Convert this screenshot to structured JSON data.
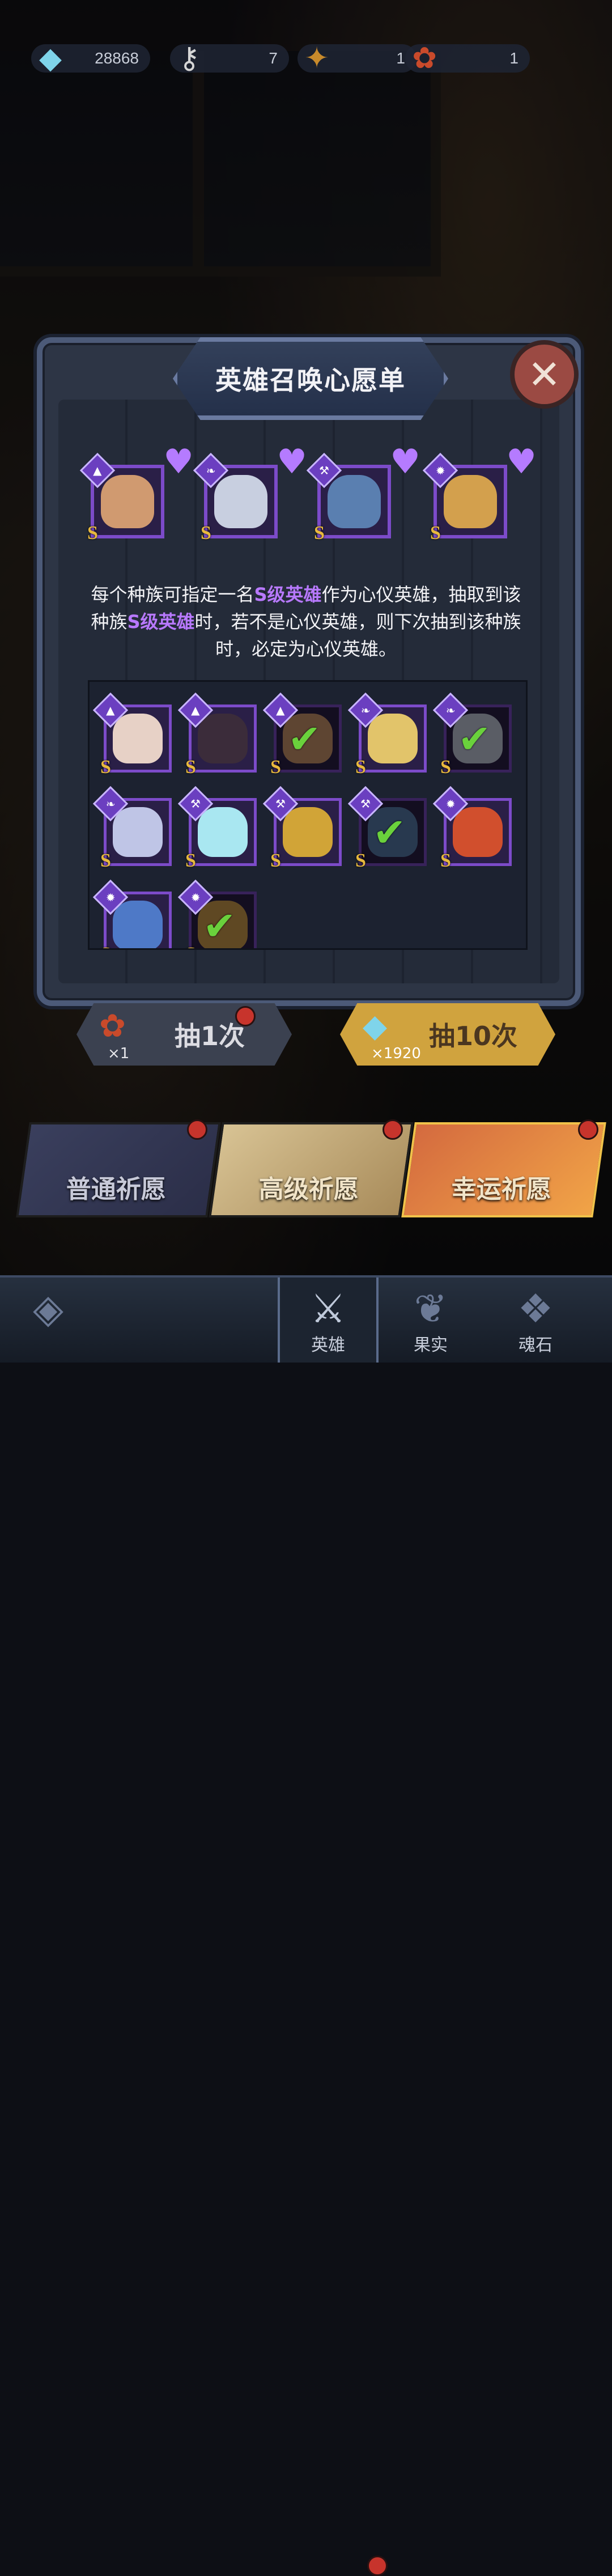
{
  "resources": [
    {
      "icon": "diamond-icon",
      "value": "28868"
    },
    {
      "icon": "key-icon",
      "value": "7"
    },
    {
      "icon": "scroll-icon",
      "value": "1"
    },
    {
      "icon": "ticket-icon",
      "value": "1"
    }
  ],
  "dialog": {
    "title": "英雄召唤心愿单",
    "close_symbol": "✕",
    "description_parts": [
      "每个种族可指定一名",
      "S级英雄",
      "作为心仪英雄，抽取到该种族",
      "S级英雄",
      "时，若不是心仪英雄，则下次抽到该种族时，必定为心仪英雄。"
    ],
    "wish_heroes": [
      {
        "race": "wizard-hat-icon",
        "tier": "S",
        "face": "#d09a70"
      },
      {
        "race": "wing-icon",
        "tier": "S",
        "face": "#c8cfe0"
      },
      {
        "race": "wrench-icon",
        "tier": "S",
        "face": "#5a7fb0"
      },
      {
        "race": "beast-icon",
        "tier": "S",
        "face": "#d3a04d"
      }
    ],
    "grid_heroes": [
      {
        "race": "wizard-hat-icon",
        "tier": "S",
        "face": "#e7d1c6",
        "owned": false
      },
      {
        "race": "wizard-hat-icon",
        "tier": "S",
        "face": "#3b2c3a",
        "owned": false
      },
      {
        "race": "wizard-hat-icon",
        "tier": "S",
        "face": "#d09a70",
        "owned": true
      },
      {
        "race": "wing-icon",
        "tier": "S",
        "face": "#e2c46a",
        "owned": false
      },
      {
        "race": "wing-icon",
        "tier": "S",
        "face": "#c8cfe0",
        "owned": true
      },
      {
        "race": "wing-icon",
        "tier": "S",
        "face": "#bfc5e6",
        "owned": false
      },
      {
        "race": "wrench-icon",
        "tier": "S",
        "face": "#a9e7f1",
        "owned": false
      },
      {
        "race": "wrench-icon",
        "tier": "S",
        "face": "#d1a437",
        "owned": false
      },
      {
        "race": "wrench-icon",
        "tier": "S",
        "face": "#5a7fb0",
        "owned": true
      },
      {
        "race": "beast-icon",
        "tier": "S",
        "face": "#d14f2d",
        "owned": false
      },
      {
        "race": "beast-icon",
        "tier": "S",
        "face": "#4e79c7",
        "owned": false
      },
      {
        "race": "beast-icon",
        "tier": "S",
        "face": "#d3a04d",
        "owned": true
      }
    ]
  },
  "draw_buttons": [
    {
      "label": "抽1次",
      "cost": "×1",
      "cost_icon": "ticket-icon"
    },
    {
      "label": "抽10次",
      "cost": "×1920",
      "cost_icon": "diamond-icon"
    }
  ],
  "banners": [
    {
      "label": "普通祈愿"
    },
    {
      "label": "高级祈愿"
    },
    {
      "label": "幸运祈愿"
    }
  ],
  "nav": [
    {
      "label": "",
      "icon": "menu-emblem-icon"
    },
    {
      "label": "英雄",
      "icon": "hero-helmet-icon"
    },
    {
      "label": "果实",
      "icon": "fruit-icon"
    },
    {
      "label": "魂石",
      "icon": "soul-stone-icon"
    }
  ],
  "colors": {
    "accent_purple": "#b879ff",
    "gold": "#d0a33e",
    "check_green": "#6ad13c"
  }
}
